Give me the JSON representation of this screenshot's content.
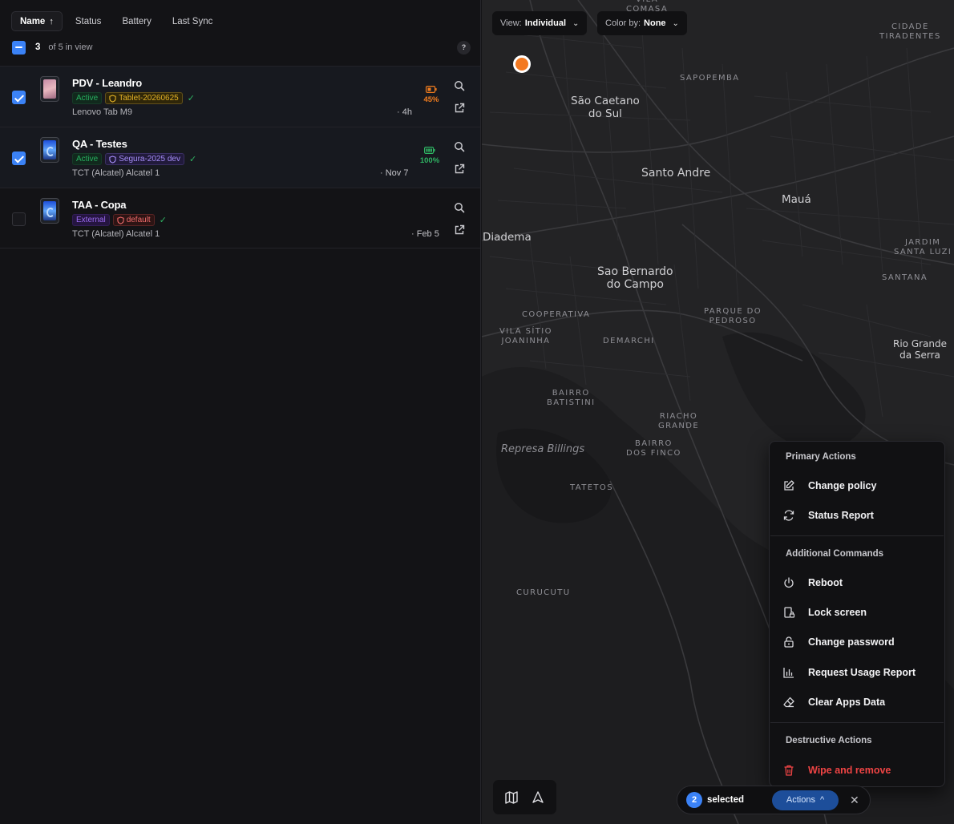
{
  "sort": {
    "name": "Name",
    "name_arrow": "↑",
    "status": "Status",
    "battery": "Battery",
    "last_sync": "Last Sync"
  },
  "selection": {
    "count": "3",
    "total_text": "of 5 in view",
    "help": "?"
  },
  "devices": [
    {
      "name": "PDV - Leandro",
      "status": "Active",
      "policy": "Tablet-20260625",
      "model": "Lenovo Tab M9",
      "last_sync": "· 4h",
      "battery": "45%",
      "battery_color": "#f07c1f",
      "selected": true
    },
    {
      "name": "QA - Testes",
      "status": "Active",
      "policy": "Segura-2025 dev",
      "model": "TCT (Alcatel) Alcatel 1",
      "last_sync": "· Nov 7",
      "battery": "100%",
      "battery_color": "#2fb463",
      "selected": true
    },
    {
      "name": "TAA - Copa",
      "status": "External",
      "policy": "default",
      "model": "TCT (Alcatel) Alcatel 1",
      "last_sync": "· Feb 5",
      "battery": "",
      "selected": false
    }
  ],
  "map": {
    "view_label": "View:",
    "view_value": "Individual",
    "color_label": "Color by:",
    "color_value": "None",
    "pin_color": "#f37921",
    "places": {
      "vila_comasa": "VILA\nCOMASA",
      "cidade_tiradentes": "CIDADE\nTIRADENTES",
      "sapopemba": "SAPOPEMBA",
      "sao_caetano": "São Caetano\ndo Sul",
      "santo_andre": "Santo Andre",
      "maua": "Mauá",
      "diadema": "Diadema",
      "jardim_santa_luzia": "JARDIM\nSANTA LUZI",
      "santana": "SANTANA",
      "sao_bernardo": "Sao Bernardo\ndo Campo",
      "cooperativa": "COOPERATIVA",
      "parque_do_pedroso": "PARQUE DO\nPEDROSO",
      "vila_sitio_joaninha": "VILA SÍTIO\nJOANINHA",
      "demarchi": "DEMARCHI",
      "rio_grande": "Rio Grande\nda Serra",
      "bairro_batistini": "BAIRRO\nBATISTINI",
      "riacho_grande": "RIACHO\nGRANDE",
      "represa_billings": "Represa Billings",
      "bairro_dos_finco": "BAIRRO\nDOS FINCO",
      "tatetos": "TATETOS",
      "curucutu": "CURUCUTU"
    }
  },
  "menu": {
    "primary_title": "Primary Actions",
    "change_policy": "Change policy",
    "status_report": "Status Report",
    "additional_title": "Additional Commands",
    "reboot": "Reboot",
    "lock_screen": "Lock screen",
    "change_password": "Change password",
    "request_usage": "Request Usage Report",
    "clear_apps": "Clear Apps Data",
    "destructive_title": "Destructive Actions",
    "wipe": "Wipe and remove"
  },
  "selection_bar": {
    "count": "2",
    "label": "selected",
    "actions": "Actions",
    "actions_chevron": "^",
    "close": "✕"
  }
}
